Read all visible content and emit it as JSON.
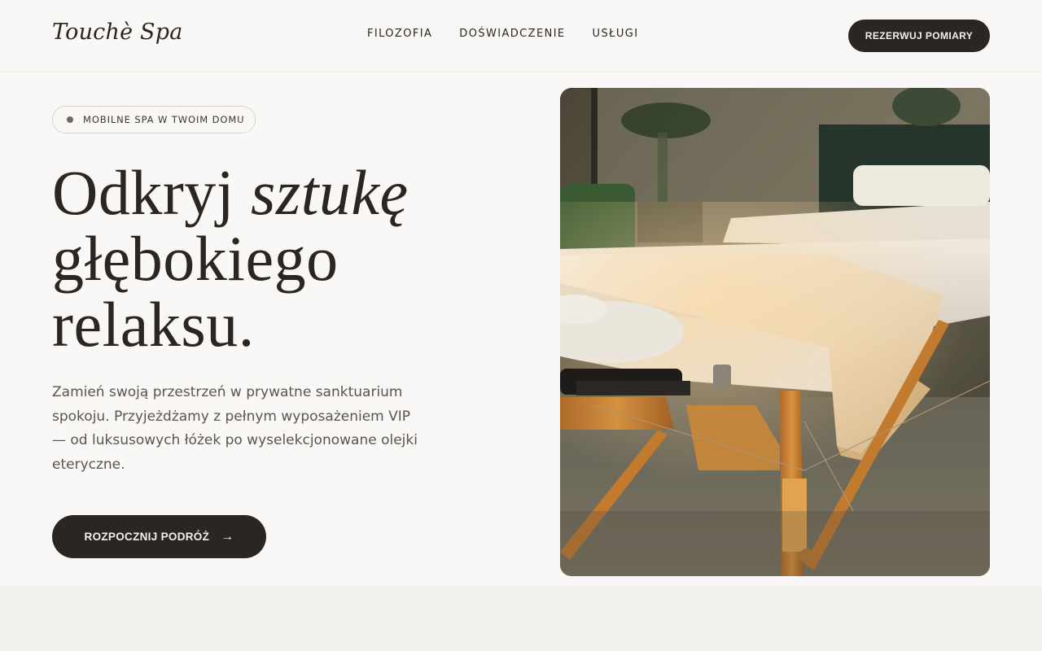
{
  "header": {
    "logo": "Touchè Spa",
    "nav": [
      {
        "label": "FILOZOFIA"
      },
      {
        "label": "DOŚWIADCZENIE"
      },
      {
        "label": "USŁUGI"
      }
    ],
    "cta_label": "REZERWUJ POMIARY"
  },
  "hero": {
    "badge": "MOBILNE SPA W TWOIM DOMU",
    "headline": {
      "line1_plain": "Odkryj ",
      "line1_italic": "sztukę",
      "line2": "głębokiego",
      "line3": "relaksu."
    },
    "lead": "Zamień swoją przestrzeń w prywatne sanktuarium spokoju. Przyjeżdżamy z pełnym wyposażeniem VIP — od luksusowych łóżek po wyselekcjonowane olejki eteryczne.",
    "cta_label": "ROZPOCZNIJ PODRÓŻ",
    "cta_icon": "arrow-right-icon",
    "image": "massage-table-photo"
  },
  "colors": {
    "background": "#f9f8f6",
    "text": "#2a2622",
    "button": "#2a2622",
    "button_text": "#f4f1ec",
    "muted_text": "#5a554f"
  }
}
